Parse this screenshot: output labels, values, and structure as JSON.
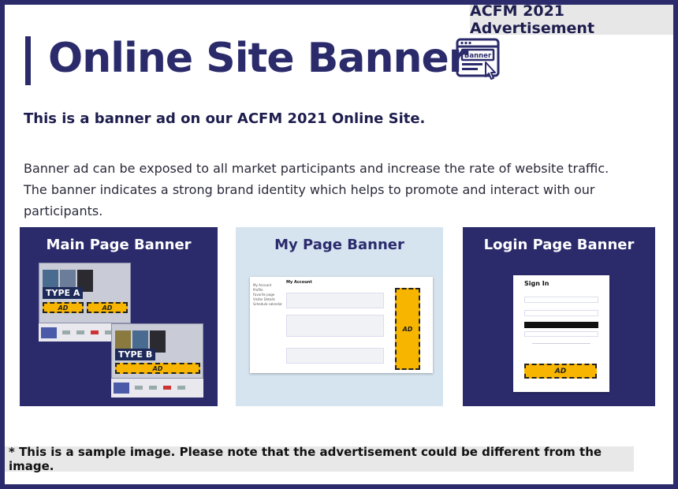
{
  "header": {
    "tag": "ACFM 2021 Advertisement",
    "title": "Online Site Banner",
    "icon": "banner-browser-icon",
    "icon_label": "Banner"
  },
  "intro": {
    "lead": "This is a banner ad on our ACFM 2021 Online Site.",
    "desc_line1": "Banner ad can be exposed to all market participants and increase the rate of website traffic.",
    "desc_line2": "The banner indicates a strong brand identity which helps to promote and interact with our participants."
  },
  "panels": {
    "main": {
      "title": "Main Page Banner",
      "type_a": "TYPE A",
      "type_b": "TYPE B",
      "ad": "AD"
    },
    "my": {
      "title": "My Page Banner",
      "heading": "My Account",
      "ad": "AD"
    },
    "login": {
      "title": "Login Page Banner",
      "heading": "Sign In",
      "ad": "AD"
    }
  },
  "footnote": "* This is a sample image. Please note that the advertisement could be different from the image.",
  "colors": {
    "navy": "#2b2b6c",
    "ad_yellow": "#f7b500",
    "light_blue": "#d6e4f0"
  }
}
